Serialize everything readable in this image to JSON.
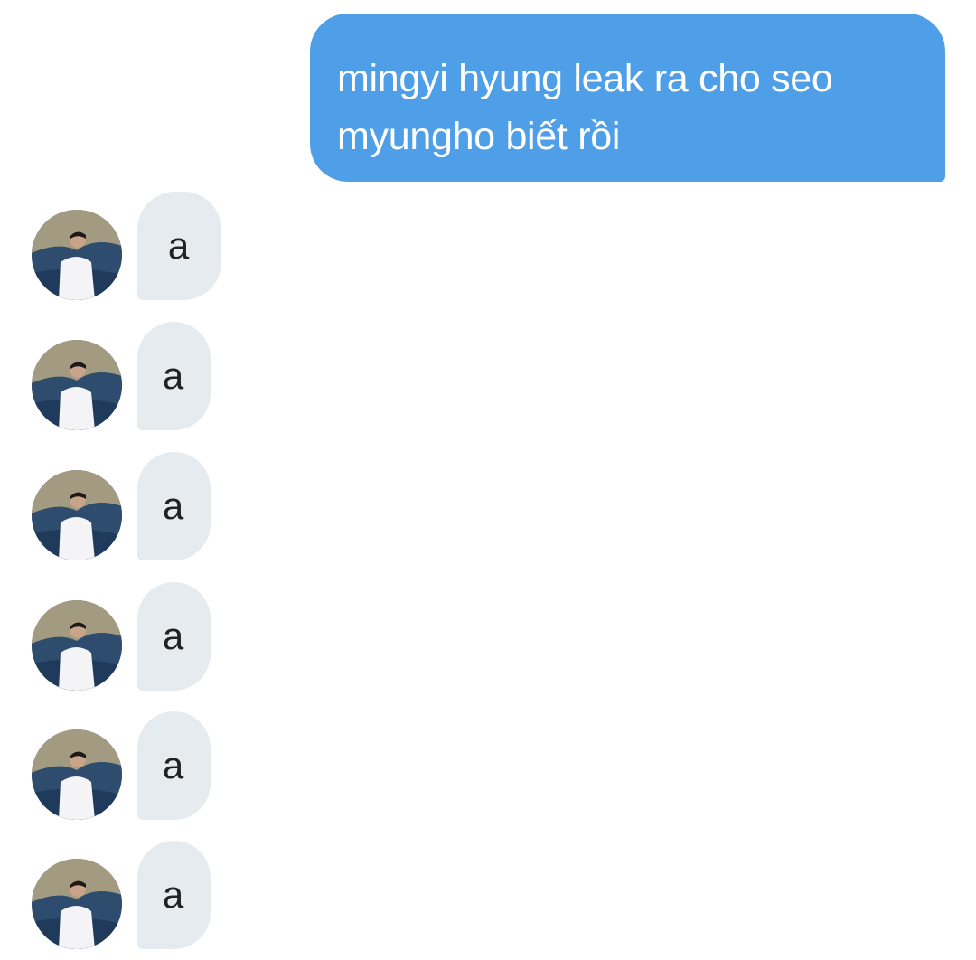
{
  "conversation": {
    "sent": [
      {
        "text": "mingyi hyung leak ra cho seo myungho biết rồi"
      }
    ],
    "received": [
      {
        "text": "a",
        "avatar": "profile-photo-icon"
      },
      {
        "text": "a",
        "avatar": "profile-photo-icon"
      },
      {
        "text": "a",
        "avatar": "profile-photo-icon"
      },
      {
        "text": "a",
        "avatar": "profile-photo-icon"
      },
      {
        "text": "a",
        "avatar": "profile-photo-icon"
      },
      {
        "text": "a",
        "avatar": "profile-photo-icon"
      }
    ]
  },
  "colors": {
    "sent_bubble": "#4f9fe8",
    "received_bubble": "#e6ebf0",
    "background": "#ffffff"
  }
}
